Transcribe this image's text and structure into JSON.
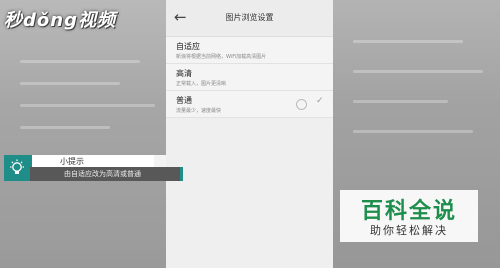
{
  "brand": {
    "logo_text": "秒dǒng视频"
  },
  "panel": {
    "title": "图片浏览设置",
    "options": [
      {
        "title": "自适应",
        "desc": "新浪将根据当前网络，WiFi加载高清图片"
      },
      {
        "title": "高清",
        "desc": "正常载入，图片更清晰"
      },
      {
        "title": "普通",
        "desc": "流量最少，速度最快"
      }
    ]
  },
  "tip": {
    "heading": "小提示",
    "body": "由自适应改为高清或普通"
  },
  "watermark": {
    "main": "百科全说",
    "sub": "助你轻松解决"
  },
  "colors": {
    "accent": "#1f8e88",
    "watermark_green": "#1d8e4c"
  }
}
